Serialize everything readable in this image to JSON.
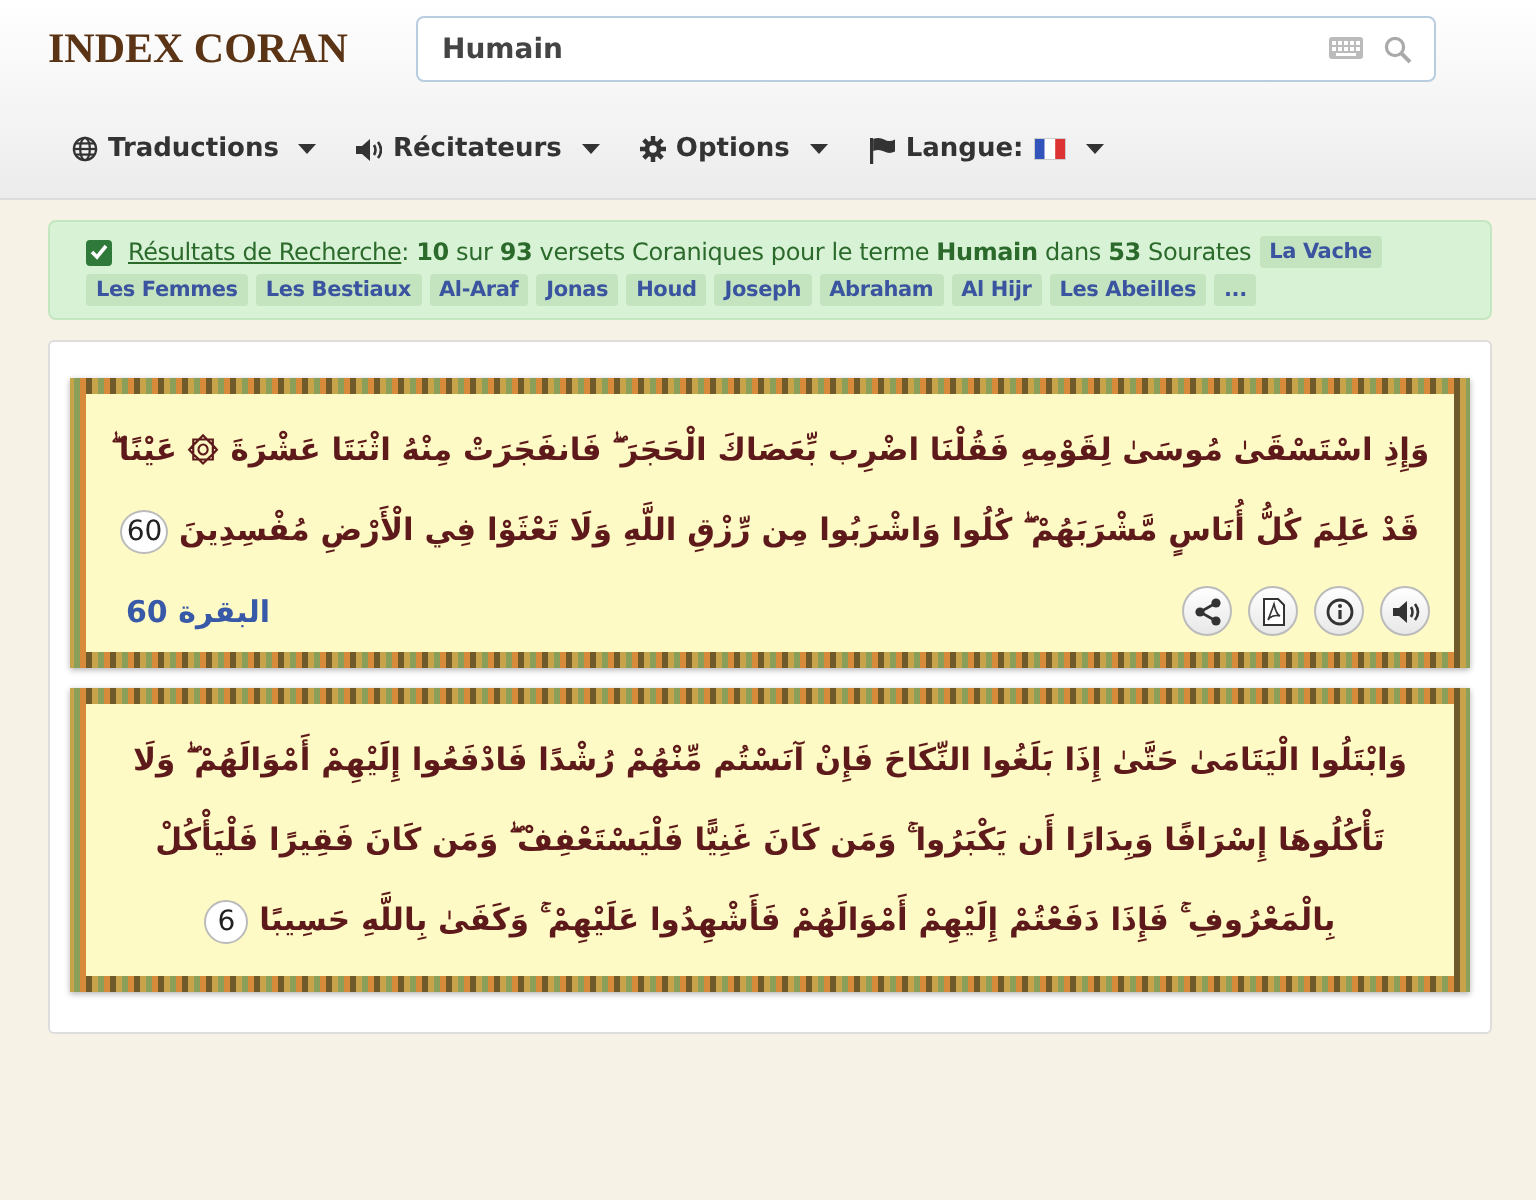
{
  "header": {
    "logo": "INDEX CORAN",
    "search": {
      "value": "Humain"
    }
  },
  "nav": [
    {
      "kind": "globe",
      "label": "Traductions"
    },
    {
      "kind": "speaker",
      "label": "Récitateurs"
    },
    {
      "kind": "gear",
      "label": "Options"
    },
    {
      "kind": "flag",
      "label": "Langue:"
    }
  ],
  "results": {
    "checked": true,
    "link": "Résultats de Recherche",
    "summary": ": **10** sur **93** versets Coraniques pour le terme **Humain** dans **53** Sourates",
    "tags": [
      "La Vache",
      "Les Femmes",
      "Les Bestiaux",
      "Al-Araf",
      "Jonas",
      "Houd",
      "Joseph",
      "Abraham",
      "Al Hijr",
      "Les Abeilles",
      "..."
    ]
  },
  "verses": [
    {
      "text": "وَإِذِ اسْتَسْقَىٰ مُوسَىٰ لِقَوْمِهِ فَقُلْنَا اضْرِب بِّعَصَاكَ الْحَجَرَ ۖ فَانفَجَرَتْ مِنْهُ اثْنَتَا عَشْرَةَ ۞ عَيْنًا ۖ قَدْ عَلِمَ كُلُّ أُنَاسٍ مَّشْرَبَهُمْ ۖ كُلُوا وَاشْرَبُوا مِن رِّزْقِ اللَّهِ وَلَا تَعْثَوْا فِي الْأَرْضِ مُفْسِدِينَ",
      "number": "60",
      "reference": "البقرة 60"
    },
    {
      "text": "وَابْتَلُوا الْيَتَامَىٰ حَتَّىٰ إِذَا بَلَغُوا النِّكَاحَ فَإِنْ آنَسْتُم مِّنْهُمْ رُشْدًا فَادْفَعُوا إِلَيْهِمْ أَمْوَالَهُمْ ۖ وَلَا تَأْكُلُوهَا إِسْرَافًا وَبِدَارًا أَن يَكْبَرُوا ۚ وَمَن كَانَ غَنِيًّا فَلْيَسْتَعْفِفْ ۖ وَمَن كَانَ فَقِيرًا فَلْيَأْكُلْ بِالْمَعْرُوفِ ۚ فَإِذَا دَفَعْتُمْ إِلَيْهِمْ أَمْوَالَهُمْ فَأَشْهِدُوا عَلَيْهِمْ ۚ وَكَفَىٰ بِاللَّهِ حَسِيبًا",
      "number": "6"
    }
  ]
}
